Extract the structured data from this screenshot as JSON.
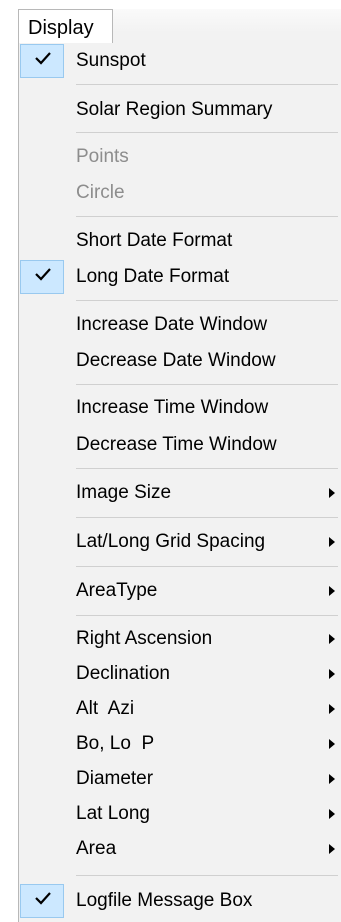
{
  "menu": {
    "title": "Display",
    "items": [
      {
        "label": "Sunspot",
        "checked": true
      },
      {
        "label": "Solar Region Summary"
      },
      {
        "label": "Points",
        "disabled": true
      },
      {
        "label": "Circle",
        "disabled": true
      },
      {
        "label": "Short Date Format"
      },
      {
        "label": "Long Date Format",
        "checked": true
      },
      {
        "label": "Increase Date Window"
      },
      {
        "label": "Decrease Date Window"
      },
      {
        "label": "Increase Time Window"
      },
      {
        "label": "Decrease Time Window"
      },
      {
        "label": "Image Size",
        "submenu": true
      },
      {
        "label": "Lat/Long Grid Spacing",
        "submenu": true
      },
      {
        "label": "AreaType",
        "submenu": true
      },
      {
        "label": "Right Ascension",
        "submenu": true
      },
      {
        "label": "Declination",
        "submenu": true
      },
      {
        "label": "Alt  Azi",
        "submenu": true
      },
      {
        "label": "Bo, Lo  P",
        "submenu": true
      },
      {
        "label": "Diameter",
        "submenu": true
      },
      {
        "label": "Lat Long",
        "submenu": true
      },
      {
        "label": "Area",
        "submenu": true
      },
      {
        "label": "Logfile Message Box",
        "checked": true
      }
    ]
  }
}
